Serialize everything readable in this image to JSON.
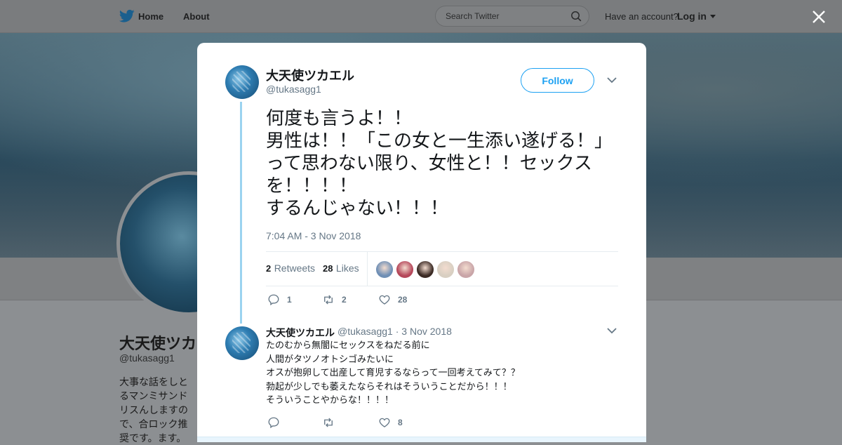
{
  "nav": {
    "home_label": "Home",
    "about_label": "About",
    "search_placeholder": "Search Twitter",
    "have_account": "Have an account?",
    "login_label": "Log in"
  },
  "background_profile": {
    "name": "大天使ツカエル",
    "handle": "@tukasagg1",
    "bio": "大事な話をしとるマンミサンドリスんしますので、合ロック推奨です。ます。"
  },
  "tweet": {
    "author_name": "大天使ツカエル",
    "author_handle": "@tukasagg1",
    "follow_label": "Follow",
    "text": "何度も言うよ！！\n男性は！！「この女と一生添い遂げる！」って思わない限り、女性と！！セックスを！！！！\nするんじゃない！！！",
    "timestamp": "7:04 AM - 3 Nov 2018",
    "retweets_count": "2",
    "retweets_label": "Retweets",
    "likes_count": "28",
    "likes_label": "Likes",
    "liker_avatar_colors": [
      "#6f8fb5",
      "#b5475a",
      "#3b2a24",
      "#d8cfc2",
      "#c9a5a8"
    ],
    "actions": {
      "replies": "1",
      "retweets": "2",
      "likes": "28"
    }
  },
  "reply": {
    "author_name": "大天使ツカエル",
    "author_handle": "@tukasagg1",
    "separator": "·",
    "date": "3 Nov 2018",
    "text": "たのむから無闇にセックスをねだる前に\n人間がタツノオトシゴみたいに\nオスが抱卵して出産して育児するならって一回考えてみて？？\n勃起が少しでも萎えたならそれはそういうことだから！！！\nそういうことやからな！！！！",
    "actions": {
      "replies": "",
      "retweets": "",
      "likes": "8"
    }
  },
  "colors": {
    "accent": "#1da1f2",
    "thread_line": "#9bd3f0",
    "text_primary": "#14171a",
    "text_secondary": "#657786"
  },
  "icons": [
    "twitter-bird-icon",
    "search-icon",
    "caret-down-icon",
    "close-icon",
    "chevron-down-icon",
    "reply-icon",
    "retweet-icon",
    "heart-icon"
  ]
}
